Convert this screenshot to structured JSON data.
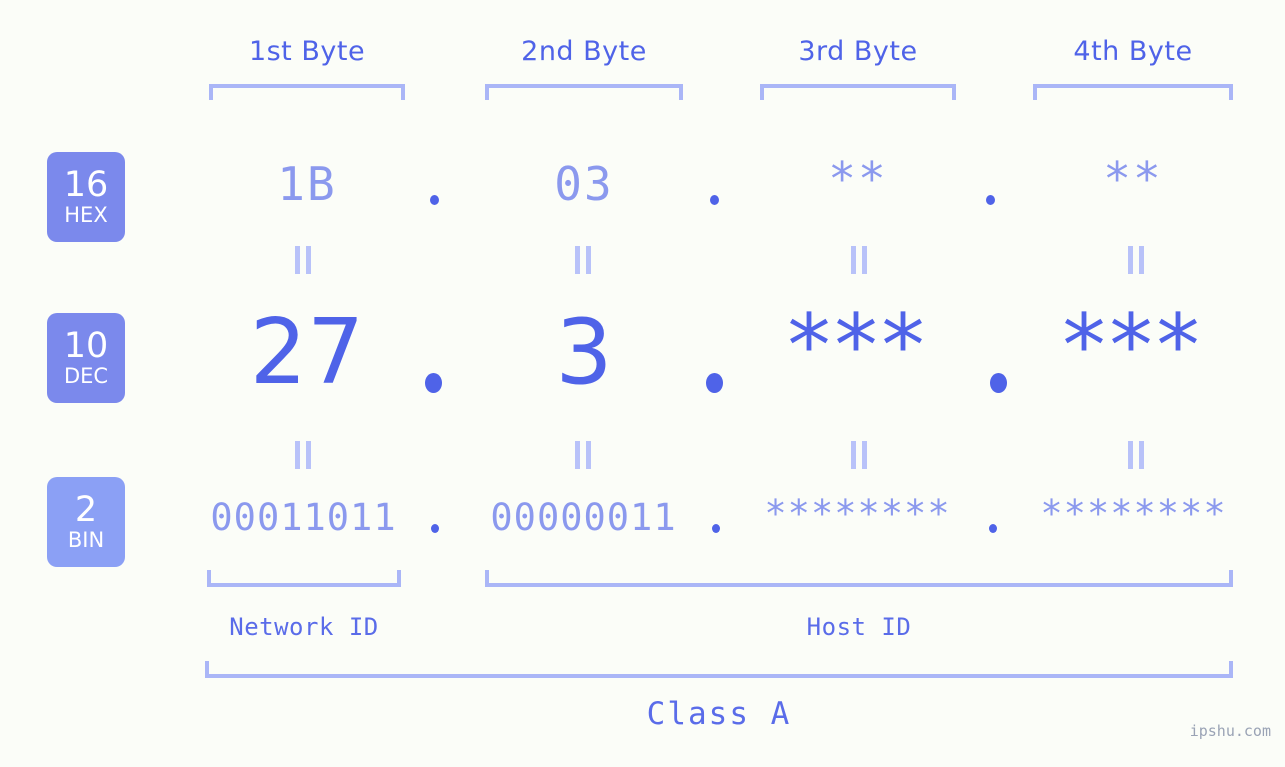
{
  "meta": {
    "watermark": "ipshu.com",
    "background_color": "#fbfdf8",
    "accent_dark": "#4f63e8",
    "accent_light": "#8b99ee",
    "bracket_color": "#aab6f7",
    "badge_color_hex": "#7b89ec",
    "badge_color_dec": "#7b89ec",
    "badge_color_bin": "#8ba0f5"
  },
  "byte_headers": [
    {
      "label": "1st Byte"
    },
    {
      "label": "2nd Byte"
    },
    {
      "label": "3rd Byte"
    },
    {
      "label": "4th Byte"
    }
  ],
  "rows": [
    {
      "badge_number": "16",
      "badge_name": "HEX",
      "values": [
        "1B",
        "03",
        "**",
        "**"
      ],
      "separator": "."
    },
    {
      "badge_number": "10",
      "badge_name": "DEC",
      "values": [
        "27",
        "3",
        "***",
        "***"
      ],
      "separator": "."
    },
    {
      "badge_number": "2",
      "badge_name": "BIN",
      "values": [
        "00011011",
        "00000011",
        "********",
        "********"
      ],
      "separator": "."
    }
  ],
  "id_sections": [
    {
      "label": "Network ID"
    },
    {
      "label": "Host ID"
    }
  ],
  "class": {
    "label": "Class A"
  }
}
